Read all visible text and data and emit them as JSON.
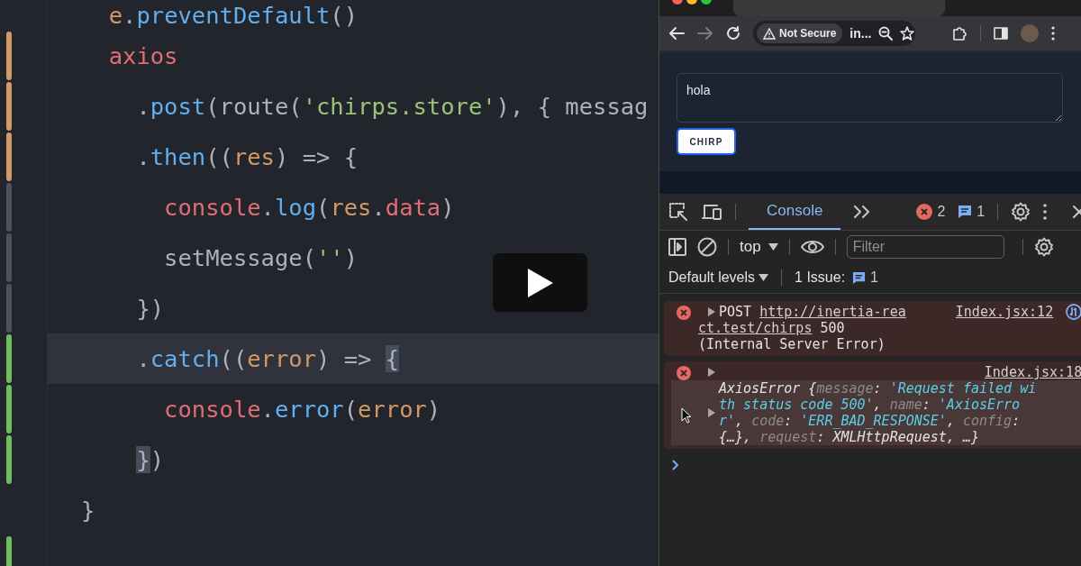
{
  "editor": {
    "lines": [
      {
        "current": false,
        "tokens": [
          {
            "text": "  e",
            "kind": "param"
          },
          {
            "text": ".",
            "kind": "plain"
          },
          {
            "text": "preventDefault",
            "kind": "method"
          },
          {
            "text": "()",
            "kind": "plain"
          }
        ]
      },
      {
        "color": "#d19a66",
        "current": false,
        "tokens": [
          {
            "text": "  axios",
            "kind": "variable"
          }
        ]
      },
      {
        "color": "#d19a66",
        "current": false,
        "tokens": [
          {
            "text": "    .",
            "kind": "plain"
          },
          {
            "text": "post",
            "kind": "method"
          },
          {
            "text": "(route(",
            "kind": "plain"
          },
          {
            "text": "'chirps.store'",
            "kind": "string"
          },
          {
            "text": "), { messag",
            "kind": "plain"
          }
        ]
      },
      {
        "color": "#d19a66",
        "current": false,
        "tokens": [
          {
            "text": "    .",
            "kind": "plain"
          },
          {
            "text": "then",
            "kind": "method"
          },
          {
            "text": "((",
            "kind": "plain"
          },
          {
            "text": "res",
            "kind": "param"
          },
          {
            "text": ") => {",
            "kind": "plain"
          }
        ]
      },
      {
        "color": "#4b5263",
        "current": false,
        "tokens": [
          {
            "text": "      console",
            "kind": "variable"
          },
          {
            "text": ".",
            "kind": "plain"
          },
          {
            "text": "log",
            "kind": "method"
          },
          {
            "text": "(",
            "kind": "plain"
          },
          {
            "text": "res",
            "kind": "param"
          },
          {
            "text": ".",
            "kind": "plain"
          },
          {
            "text": "data",
            "kind": "variable"
          },
          {
            "text": ")",
            "kind": "plain"
          }
        ]
      },
      {
        "color": "#4b5263",
        "current": false,
        "tokens": [
          {
            "text": "      setMessage(",
            "kind": "plain"
          },
          {
            "text": "''",
            "kind": "string"
          },
          {
            "text": ")",
            "kind": "plain"
          }
        ]
      },
      {
        "color": "#4b5263",
        "current": false,
        "tokens": [
          {
            "text": "    })",
            "kind": "plain"
          }
        ]
      },
      {
        "color": "#6cbf5b",
        "current": true,
        "tokens": [
          {
            "text": "    .",
            "kind": "plain"
          },
          {
            "text": "catch",
            "kind": "method"
          },
          {
            "text": "((",
            "kind": "plain"
          },
          {
            "text": "error",
            "kind": "param"
          },
          {
            "text": ") => ",
            "kind": "plain"
          },
          {
            "text": "{",
            "kind": "match"
          }
        ]
      },
      {
        "color": "#6cbf5b",
        "current": false,
        "tokens": [
          {
            "text": "      console",
            "kind": "variable"
          },
          {
            "text": ".",
            "kind": "plain"
          },
          {
            "text": "error",
            "kind": "method"
          },
          {
            "text": "(",
            "kind": "plain"
          },
          {
            "text": "error",
            "kind": "param"
          },
          {
            "text": ")",
            "kind": "plain"
          }
        ]
      },
      {
        "color": "#6cbf5b",
        "current": false,
        "tokens": [
          {
            "text": "    }",
            "kind": "match"
          },
          {
            "text": ")",
            "kind": "plain"
          }
        ]
      },
      {
        "current": false,
        "tokens": [
          {
            "text": "}",
            "kind": "plain"
          }
        ]
      },
      {
        "color": "#6cbf5b",
        "current": false
      }
    ]
  },
  "browser": {
    "address_bar": {
      "security_label": "Not Secure",
      "url": "in..."
    },
    "page": {
      "message_field": {
        "value": "hola"
      },
      "submit_button": "CHIRP"
    },
    "devtools": {
      "tabs": [
        {
          "label": "Console",
          "selected": true
        }
      ],
      "error_count": "2",
      "message_count": "1",
      "context": "top",
      "filter": {
        "placeholder": "Filter"
      },
      "levels": "Default levels",
      "issues_label": "1 Issue:",
      "issues_count": "1",
      "messages": [
        {
          "error": true,
          "kind": "network",
          "source": "Index.jsx:12",
          "lines": [
            [
              {
                "text": "POST ",
                "kind": "plain"
              },
              {
                "text": "http://inertia-rea",
                "kind": "link"
              }
            ],
            [
              {
                "text": "ct.test/chirps",
                "kind": "link"
              },
              {
                "text": " 500",
                "kind": "plain"
              }
            ],
            [
              {
                "text": "(Internal Server Error)",
                "kind": "plain"
              }
            ]
          ]
        },
        {
          "error": true,
          "kind": "object",
          "source": "Index.jsx:18",
          "lines": [
            [
              {
                "text": "AxiosError {",
                "kind": "plain"
              },
              {
                "text": "message",
                "kind": "key"
              },
              {
                "text": ": ",
                "kind": "plain"
              },
              {
                "text": "'Request failed wi",
                "kind": "string"
              }
            ],
            [
              {
                "text": "th status code 500'",
                "kind": "string"
              },
              {
                "text": ", ",
                "kind": "plain"
              },
              {
                "text": "name",
                "kind": "key"
              },
              {
                "text": ": ",
                "kind": "plain"
              },
              {
                "text": "'AxiosErro",
                "kind": "string"
              }
            ],
            [
              {
                "text": "r'",
                "kind": "string"
              },
              {
                "text": ", ",
                "kind": "plain"
              },
              {
                "text": "code",
                "kind": "key"
              },
              {
                "text": ": ",
                "kind": "plain"
              },
              {
                "text": "'ERR_BAD_RESPONSE'",
                "kind": "string"
              },
              {
                "text": ", ",
                "kind": "plain"
              },
              {
                "text": "config",
                "kind": "key"
              },
              {
                "text": ":",
                "kind": "plain"
              }
            ],
            [
              {
                "text": "{…}, ",
                "kind": "plain"
              },
              {
                "text": "request",
                "kind": "key"
              },
              {
                "text": ": XMLHttpRequest, …}",
                "kind": "plain"
              }
            ]
          ]
        }
      ]
    }
  }
}
